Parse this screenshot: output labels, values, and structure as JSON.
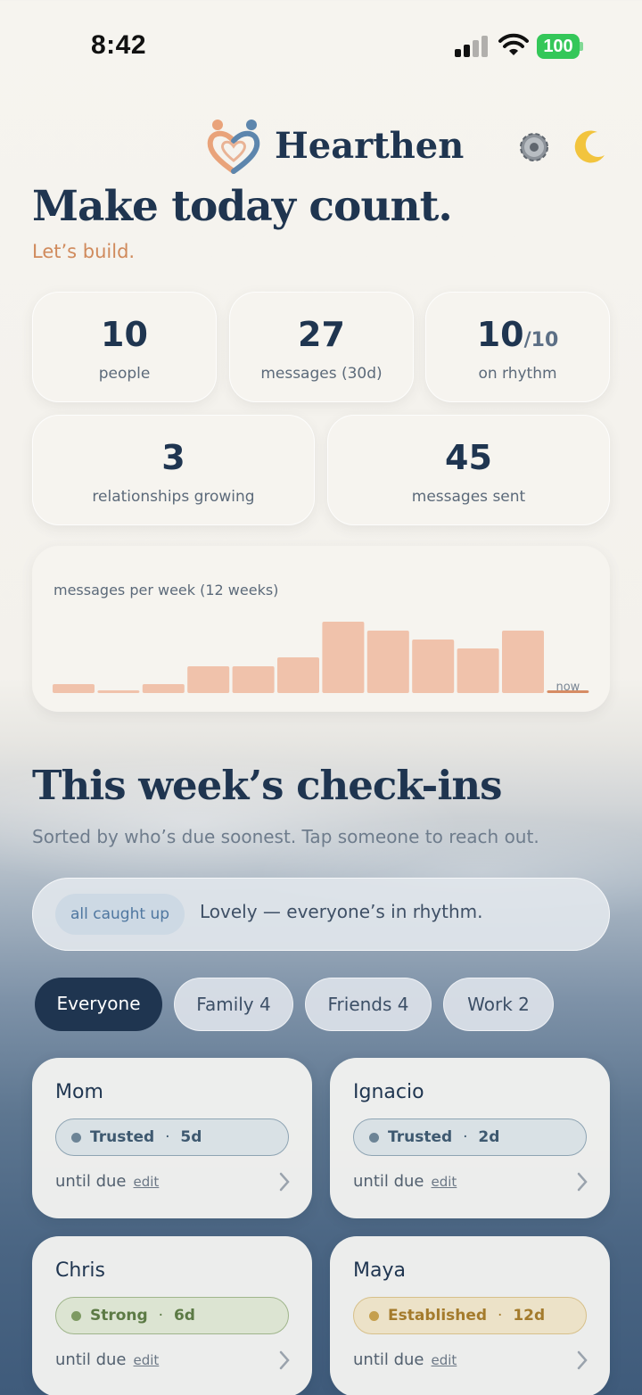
{
  "status_bar": {
    "time": "8:42",
    "battery": "100"
  },
  "header": {
    "brand": "Hearthen",
    "logo_icon": "heart-people-logo",
    "settings_icon": "gear-icon",
    "theme_icon": "moon-icon"
  },
  "hero": {
    "title": "Make today count.",
    "subtitle": "Let’s build."
  },
  "stats": {
    "people": {
      "value": "10",
      "label": "people"
    },
    "messages_30d": {
      "value": "27",
      "label": "messages (30d)"
    },
    "on_rhythm": {
      "value": "10",
      "total": "/10",
      "label": "on rhythm"
    },
    "growing": {
      "value": "3",
      "label": "relationships growing"
    },
    "sent": {
      "value": "45",
      "label": "messages sent"
    }
  },
  "chart_data": {
    "type": "bar",
    "title": "messages per week (12 weeks)",
    "categories": [
      "",
      "",
      "",
      "",
      "",
      "",
      "",
      "",
      "",
      "",
      "",
      "now"
    ],
    "values": [
      1,
      0.3,
      1,
      3,
      3,
      4,
      8,
      7,
      6,
      5,
      7,
      0
    ],
    "ylim": [
      0,
      8
    ],
    "color": "#f0c2ab",
    "current_color": "#d68c64"
  },
  "checkins": {
    "title": "This week’s check-ins",
    "subtitle": "Sorted by who’s due soonest. Tap someone to reach out.",
    "banner_pill": "all caught up",
    "banner_text": "Lovely — everyone’s in rhythm."
  },
  "filters": [
    {
      "label": "Everyone"
    },
    {
      "label": "Family 4"
    },
    {
      "label": "Friends 4"
    },
    {
      "label": "Work 2"
    }
  ],
  "people": [
    {
      "name": "Mom",
      "status": "Trusted",
      "days": "5d",
      "due_label": "until due",
      "edit_label": "edit"
    },
    {
      "name": "Ignacio",
      "status": "Trusted",
      "days": "2d",
      "due_label": "until due",
      "edit_label": "edit"
    },
    {
      "name": "Chris",
      "status": "Strong",
      "days": "6d",
      "due_label": "until due",
      "edit_label": "edit"
    },
    {
      "name": "Maya",
      "status": "Established",
      "days": "12d",
      "due_label": "until due",
      "edit_label": "edit"
    }
  ],
  "separator": "·",
  "colors": {
    "navy": "#1f3550",
    "accent": "#d08a5c",
    "trusted": "#6c8496",
    "strong": "#7e9a63",
    "established": "#c59f4d"
  }
}
